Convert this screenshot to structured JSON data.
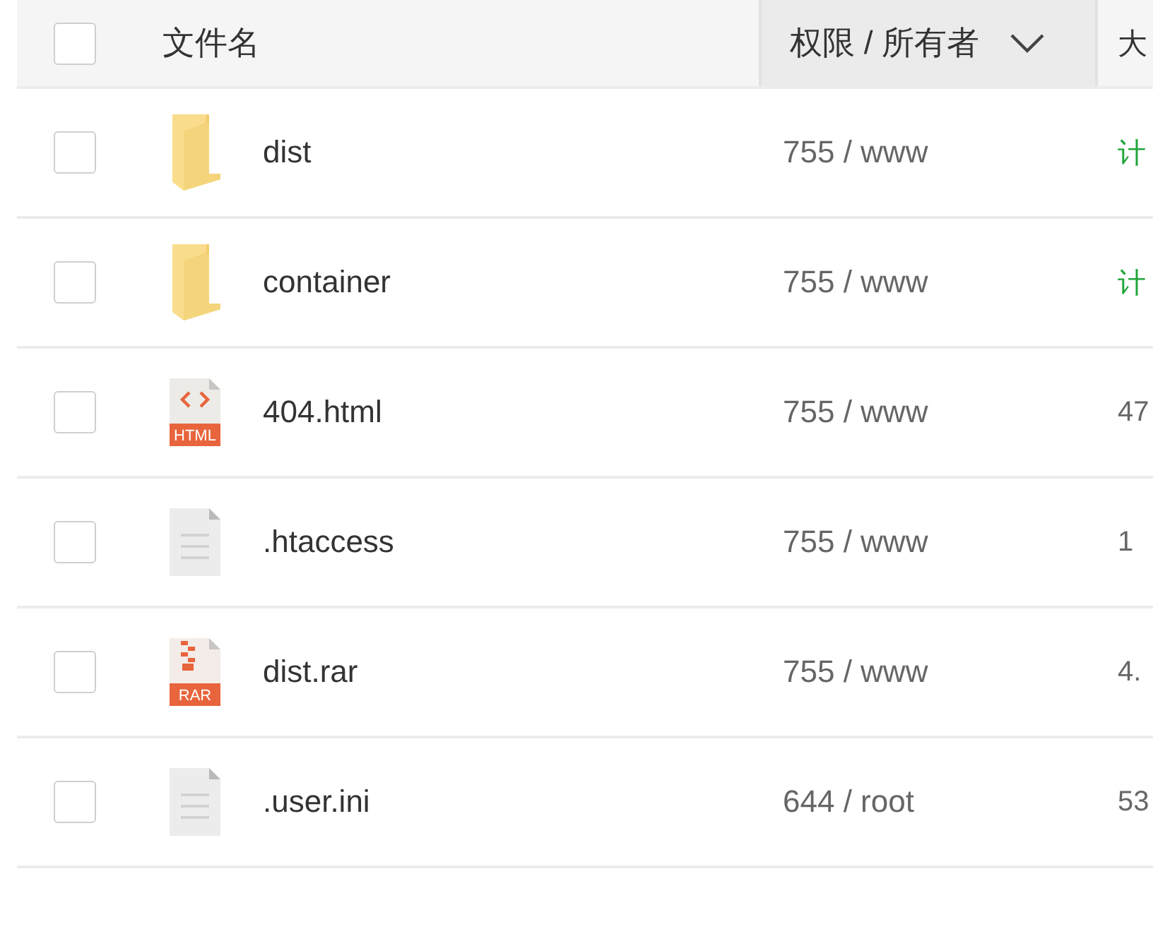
{
  "header": {
    "select_all": {
      "checked": false
    },
    "columns": [
      {
        "label": "文件名",
        "sorted": false
      },
      {
        "label": "权限 / 所有者",
        "sorted": true
      },
      {
        "label": "大",
        "sorted": false
      }
    ]
  },
  "rows": [
    {
      "checked": false,
      "kind": "folder",
      "name": "dist",
      "permission": "755 / www",
      "size": {
        "text": "计",
        "kind": "link"
      }
    },
    {
      "checked": false,
      "kind": "folder",
      "name": "container",
      "permission": "755 / www",
      "size": {
        "text": "计",
        "kind": "link"
      }
    },
    {
      "checked": false,
      "kind": "html",
      "badge": "HTML",
      "name": "404.html",
      "permission": "755 / www",
      "size": {
        "text": "47",
        "kind": "plain"
      }
    },
    {
      "checked": false,
      "kind": "text",
      "name": ".htaccess",
      "permission": "755 / www",
      "size": {
        "text": "1",
        "kind": "plain"
      }
    },
    {
      "checked": false,
      "kind": "archive",
      "badge": "RAR",
      "name": "dist.rar",
      "permission": "755 / www",
      "size": {
        "text": "4.",
        "kind": "plain"
      }
    },
    {
      "checked": false,
      "kind": "text",
      "name": ".user.ini",
      "permission": "644 / root",
      "size": {
        "text": "53",
        "kind": "plain"
      }
    }
  ]
}
